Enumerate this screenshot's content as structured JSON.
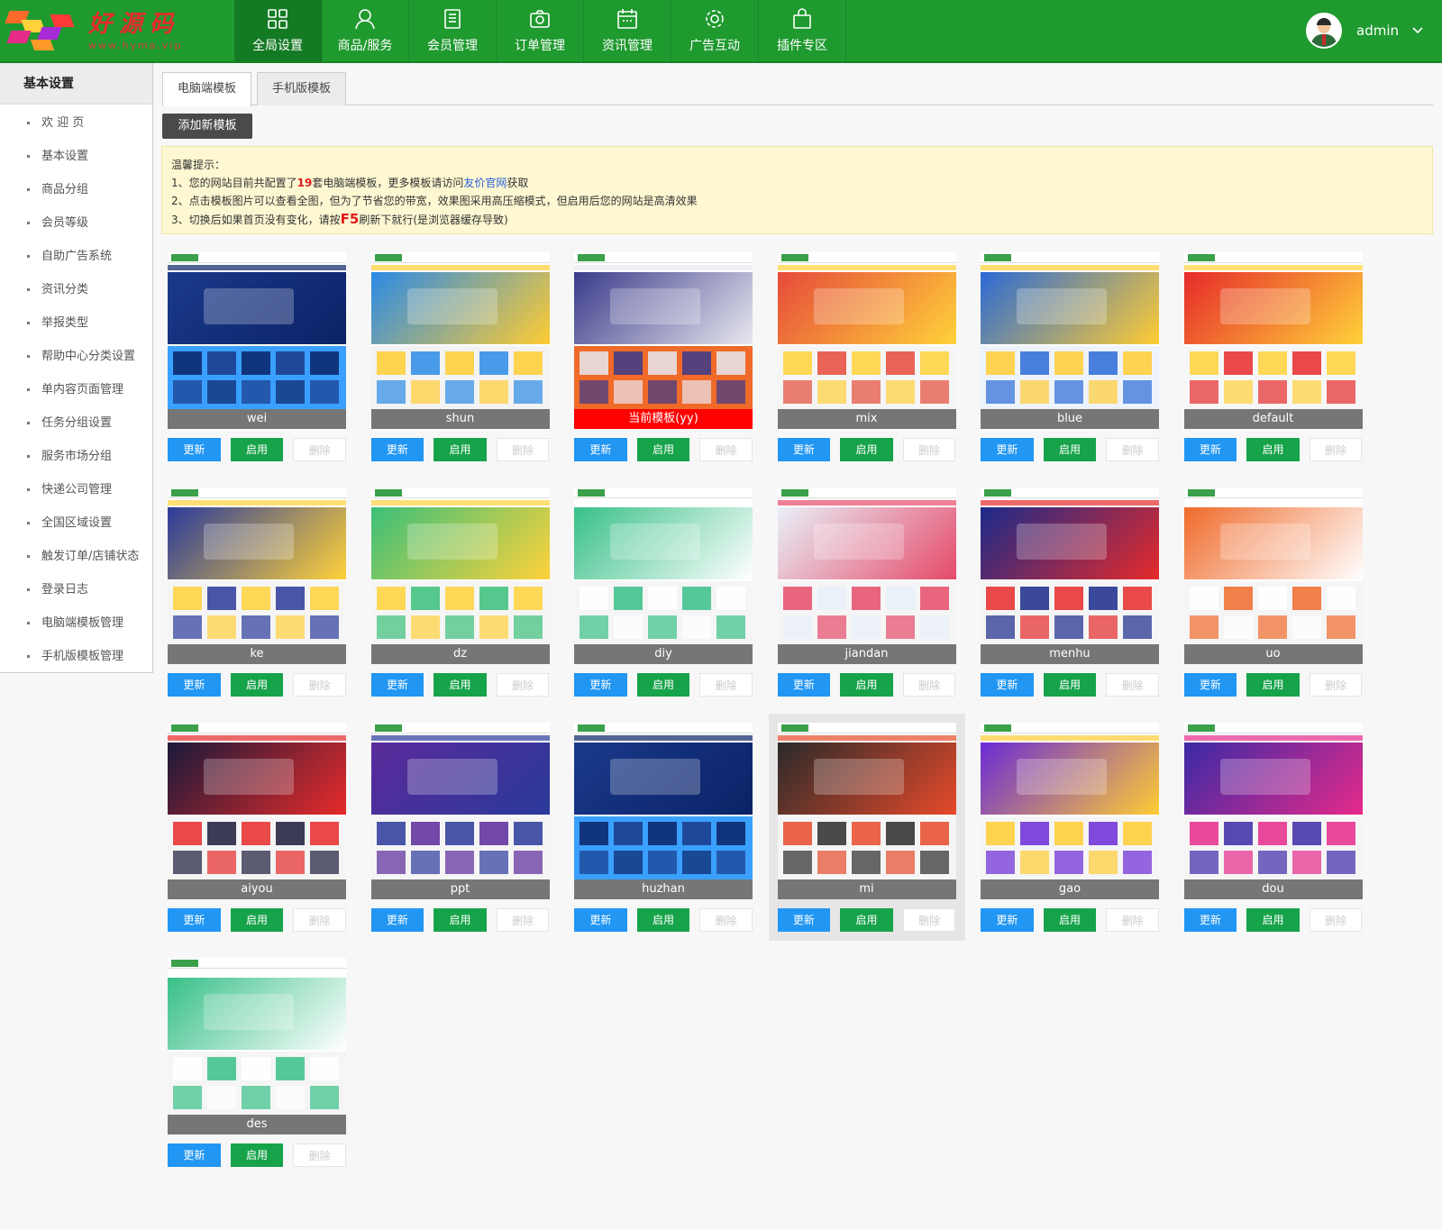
{
  "logo": {
    "cn": "好源码",
    "en": "www.hyma.vip"
  },
  "nav": [
    {
      "label": "全局设置",
      "icon": "grid-icon"
    },
    {
      "label": "商品/服务",
      "icon": "user-icon"
    },
    {
      "label": "会员管理",
      "icon": "doc-list-icon"
    },
    {
      "label": "订单管理",
      "icon": "camera-icon"
    },
    {
      "label": "资讯管理",
      "icon": "calendar-icon"
    },
    {
      "label": "广告互动",
      "icon": "gear-icon"
    },
    {
      "label": "插件专区",
      "icon": "bag-icon"
    }
  ],
  "user": {
    "name": "admin"
  },
  "sidebar": {
    "title": "基本设置",
    "items": [
      "欢 迎 页",
      "基本设置",
      "商品分组",
      "会员等级",
      "自助广告系统",
      "资讯分类",
      "举报类型",
      "帮助中心分类设置",
      "单内容页面管理",
      "任务分组设置",
      "服务市场分组",
      "快递公司管理",
      "全国区域设置",
      "触发订单/店铺状态",
      "登录日志",
      "电脑端模板管理",
      "手机版模板管理"
    ]
  },
  "tabs": [
    "电脑端模板",
    "手机版模板"
  ],
  "add_button": "添加新模板",
  "notice": {
    "title": "温馨提示：",
    "l1_a": "1、您的网站目前共配置了",
    "l1_count": "19",
    "l1_b": "套电脑端模板，更多模板请访问",
    "l1_link": "友价官网",
    "l1_c": "获取",
    "l2": "2、点击模板图片可以查看全图，但为了节省您的带宽，效果图采用高压缩模式，但启用后您的网站是高清效果",
    "l3_a": "3、切换后如果首页没有变化，请按",
    "l3_key": "F5",
    "l3_b": "刷新下就行(是浏览器缓存导致)"
  },
  "buttons": {
    "update": "更新",
    "enable": "启用",
    "delete": "删除"
  },
  "templates": [
    {
      "name": "wei",
      "colors": [
        "#1a3a8a",
        "#0b2266",
        "#3aa0ff"
      ]
    },
    {
      "name": "shun",
      "colors": [
        "#2a8ae6",
        "#ffcc33",
        "#f3f3f3"
      ]
    },
    {
      "name": "当前模板(yy)",
      "current": true,
      "colors": [
        "#3a3a8a",
        "#e8e8f0",
        "#f06a2a"
      ]
    },
    {
      "name": "mix",
      "colors": [
        "#e64a3a",
        "#ffd23a",
        "#f5f5f5"
      ]
    },
    {
      "name": "blue",
      "colors": [
        "#2a6ad6",
        "#ffcc33",
        "#eef3fb"
      ]
    },
    {
      "name": "default",
      "colors": [
        "#e62a2a",
        "#ffd23a",
        "#f7f7f7"
      ]
    },
    {
      "name": "ke",
      "colors": [
        "#2a3a9a",
        "#ffd23a",
        "#f5f5f5"
      ]
    },
    {
      "name": "dz",
      "colors": [
        "#3ac07a",
        "#ffd23a",
        "#f5f5f5"
      ]
    },
    {
      "name": "diy",
      "colors": [
        "#38c088",
        "#ffffff",
        "#f5f5f5"
      ]
    },
    {
      "name": "jiandan",
      "colors": [
        "#e8f0f8",
        "#e64a6a",
        "#f5f5f5"
      ]
    },
    {
      "name": "menhu",
      "colors": [
        "#1a2a8a",
        "#e62a2a",
        "#f5f5f5"
      ]
    },
    {
      "name": "uo",
      "colors": [
        "#f06a2a",
        "#ffffff",
        "#f5f5f5"
      ]
    },
    {
      "name": "aiyou",
      "colors": [
        "#1a1a3a",
        "#e62a2a",
        "#f5f5f5"
      ]
    },
    {
      "name": "ppt",
      "colors": [
        "#5a2a9a",
        "#2a3a9a",
        "#f5f5f5"
      ]
    },
    {
      "name": "huzhan",
      "colors": [
        "#1a3a8a",
        "#0b2266",
        "#3aa0ff"
      ]
    },
    {
      "name": "mi",
      "hover": true,
      "colors": [
        "#2a2a2a",
        "#e64a2a",
        "#f5f5f5"
      ]
    },
    {
      "name": "gao",
      "colors": [
        "#6a2ad6",
        "#ffcc33",
        "#f5f5f5"
      ]
    },
    {
      "name": "dou",
      "colors": [
        "#3a2aa6",
        "#e62a8a",
        "#f5f5f5"
      ]
    },
    {
      "name": "des",
      "colors": [
        "#38c088",
        "#ffffff",
        "#f5f5f5"
      ]
    }
  ]
}
